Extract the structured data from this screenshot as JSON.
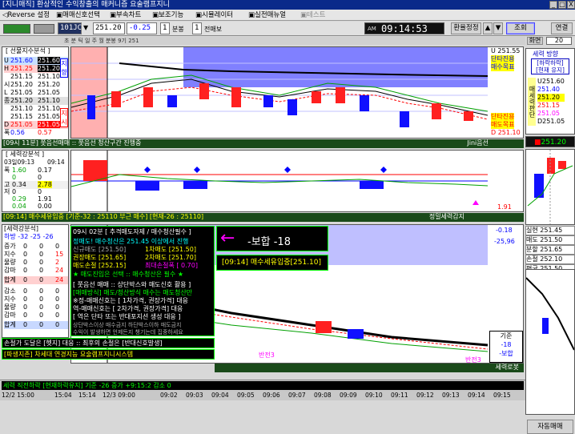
{
  "window": {
    "title": "[지니매직] 환상적인 수익창출의 매커니즘 요술램프지니",
    "btn_min": "_",
    "btn_max": "□",
    "btn_close": "X"
  },
  "menu": [
    {
      "label": "◁Reverse 설정"
    },
    {
      "label": "▣매매신호선택"
    },
    {
      "label": "▣부속차트"
    },
    {
      "label": "▣보조기능"
    },
    {
      "label": "▣시뮬레이터"
    },
    {
      "label": "▣실전매뉴얼"
    },
    {
      "label": "▣테스트"
    }
  ],
  "toolbar": {
    "code": "101JC",
    "price": "251.20",
    "change": "-0.25",
    "interval": "1",
    "interval_unit": "분봉",
    "count": "1",
    "count_unit": "전매보",
    "am_label": "AM",
    "clock": "09:14:53",
    "fx_button": "환율정정",
    "up_arrow": "▲",
    "down_arrow": "▼",
    "search_button": "조회",
    "link_button": "연결",
    "screen_label": "화면",
    "screen_value": "20"
  },
  "tabs_line": "초 분 틱 일 주 월   분봉 9기 251",
  "top_left": {
    "header": "[ 선물지수분석 ]",
    "rows": [
      {
        "k": "U",
        "a": "251.60",
        "b": "251.60"
      },
      {
        "k": "H",
        "a": "251.25",
        "b": "251.20"
      },
      {
        "k": "",
        "a": "251.15",
        "b": "251.10"
      },
      {
        "k": "시",
        "a": "251.20",
        "b": "251.20"
      },
      {
        "k": "L",
        "a": "251.05",
        "b": "251.05"
      },
      {
        "k": "종",
        "a": "251.20",
        "b": "251.10"
      },
      {
        "k": "",
        "a": "251.10",
        "b": "251.10"
      },
      {
        "k": "",
        "a": "251.15",
        "b": "251.05"
      },
      {
        "k": "D",
        "a": "251.05",
        "b": "251.05"
      },
      {
        "k": "폭",
        "a": "0.56",
        "b": "0.57"
      }
    ],
    "side_up": "지향",
    "side_down": "지시"
  },
  "top_chart": {
    "right_value": "U 251.55",
    "right_label1": "단타진용",
    "right_label2": "매수목표",
    "right_label3": "단타진용",
    "right_label4": "매도목표",
    "right_low": "D 251.10",
    "status_left": "[09시 11분] 쭛음선매매 :: 쭛음선 청산구간 진행중",
    "status_right": "Jini음선"
  },
  "mid_left": {
    "header": "[ 세력강분석 ]",
    "time_a": "03일09:13",
    "time_b": "09:14",
    "rows": [
      {
        "k": "폭",
        "a": "1.60",
        "b": "0.17"
      },
      {
        "k": "",
        "a": "0",
        "b": "0"
      },
      {
        "k": "고",
        "a": "0.34",
        "b": "2.78"
      },
      {
        "k": "저",
        "a": "0",
        "b": "0"
      },
      {
        "k": "",
        "a": "0.29",
        "b": "1.91"
      },
      {
        "k": "",
        "a": "0.04",
        "b": "0.00"
      }
    ]
  },
  "mid_chart": {
    "right_value": "1.91",
    "status_left": "[09:14] 매수세유입중 [기준-32 : 25110 부근 매수] [현재-26 : 25110]",
    "status_right": "정밀세력감지"
  },
  "bottom_left": {
    "header": "[세력강분석]",
    "sub": "하방 -32   -25  -26",
    "rows1": [
      {
        "k": "증가",
        "a": "0",
        "b": "0",
        "c": "0"
      },
      {
        "k": "지수",
        "a": "0",
        "b": "0",
        "c": "15"
      },
      {
        "k": "물량",
        "a": "0",
        "b": "0",
        "c": "2"
      },
      {
        "k": "감마",
        "a": "0",
        "b": "0",
        "c": "24"
      }
    ],
    "sum1": {
      "k": "합계",
      "a": "0",
      "b": "0",
      "c": "24"
    },
    "rows2": [
      {
        "k": "감소",
        "a": "0",
        "b": "0",
        "c": "0"
      },
      {
        "k": "지수",
        "a": "0",
        "b": "0",
        "c": "0"
      },
      {
        "k": "물량",
        "a": "0",
        "b": "0",
        "c": "0"
      },
      {
        "k": "감마",
        "a": "0",
        "b": "0",
        "c": "0"
      }
    ],
    "sum2": {
      "k": "합계",
      "a": "0",
      "b": "0",
      "c": "0"
    }
  },
  "info_box": {
    "line0": "09시 02분 [ 추격매도자제 / 매수청산필수 ]",
    "line1": "정매도! 매수청산은 251.45 이상에서 진행",
    "line2a": "신규매도 [251.50]",
    "line2b": "1차매도 [251.50]",
    "line3a": "권장매도 [251.65]",
    "line3b": "2차매도 [251.70]",
    "line4a": "매도손절 [252.15]",
    "line4b": "최대손절폭 [ 0.70]",
    "line5": "★ 매도진입은 선택  ::  매수청산은 필수 ★",
    "line6": "[ 쭛음선 매매 :: 상단박스와 매도신호 활용 ]",
    "line7": "[매매방식] 매도/청산방식 매수는 매도청산만",
    "line8": "※정-매매신호는 [ 1차가격, 권장가격] 대응",
    "line9": "  역-매매신호는 [ 2차가격, 권장가격] 대응",
    "line10": "[ 역은 단타 또는  반대포지션 생성 대응 ]",
    "line11": "상단박스이상 매수금지  하단박스이하 매도금지",
    "line12": "수익이 발생하면 언제든지 챙기는데 집중하세요",
    "footer1": "손절가 도달은 [헷지] 대응 :: 최후의 손절은 [반대신호발생]",
    "footer2": "[파생지존] 차세대 연경지능 요술램프지니시스템"
  },
  "callout": {
    "text": "-보합 -18",
    "arrow": "←"
  },
  "signal_box": {
    "text": "[09:14] 매수세유입중[251.10]"
  },
  "bottom_chart": {
    "v1": "-0.18",
    "v2": "-25,96",
    "label_a": "반전3",
    "label_b": "반전3",
    "box_title": "기준",
    "box_v1": "-18",
    "box_v2": "-보합",
    "status_right": "세력로봇"
  },
  "status_bar": {
    "line1": "세력 직전하락 [현재하락유지] 기준 -26  증가 +9:15:2  감소 0",
    "times": [
      "12/2 15:00",
      "15:04",
      "15:14",
      "12/3 09:00",
      "09:02",
      "09:03",
      "09:04",
      "09:05",
      "09:06",
      "09:07",
      "09:08",
      "09:09",
      "09:10",
      "09:11",
      "09:12",
      "09:13",
      "09:14",
      "09:15"
    ]
  },
  "right_panel": {
    "top_label": "세력 방향",
    "dir_box": "[하락하락]",
    "dir_sub": "[현재 유지]",
    "vert_text": "매세력판단",
    "levels": [
      {
        "label": "U",
        "value": "251.60"
      },
      {
        "label": "",
        "value": "251.40"
      },
      {
        "label": "",
        "value": "251.20"
      },
      {
        "label": "",
        "value": "251.15"
      },
      {
        "label": "",
        "value": "251.05"
      },
      {
        "label": "D",
        "value": "251.05"
      }
    ],
    "current": "251.20",
    "stats": [
      {
        "k": "실현",
        "v": "251.45"
      },
      {
        "k": "매도",
        "v": "251.50"
      },
      {
        "k": "분할",
        "v": "251.65"
      },
      {
        "k": "손절",
        "v": "252.10"
      },
      {
        "k": "평균",
        "v": "251.50"
      }
    ],
    "auto_button": "자동매매"
  },
  "colors": {
    "chart_bg": "#ffffff",
    "blue_zone": "#7070ff",
    "pink_zone": "#ffb0b0",
    "candle_red": "#ff2020",
    "candle_blue": "#1010ff",
    "panel_dark": "#000000",
    "green_text": "#00a000"
  }
}
